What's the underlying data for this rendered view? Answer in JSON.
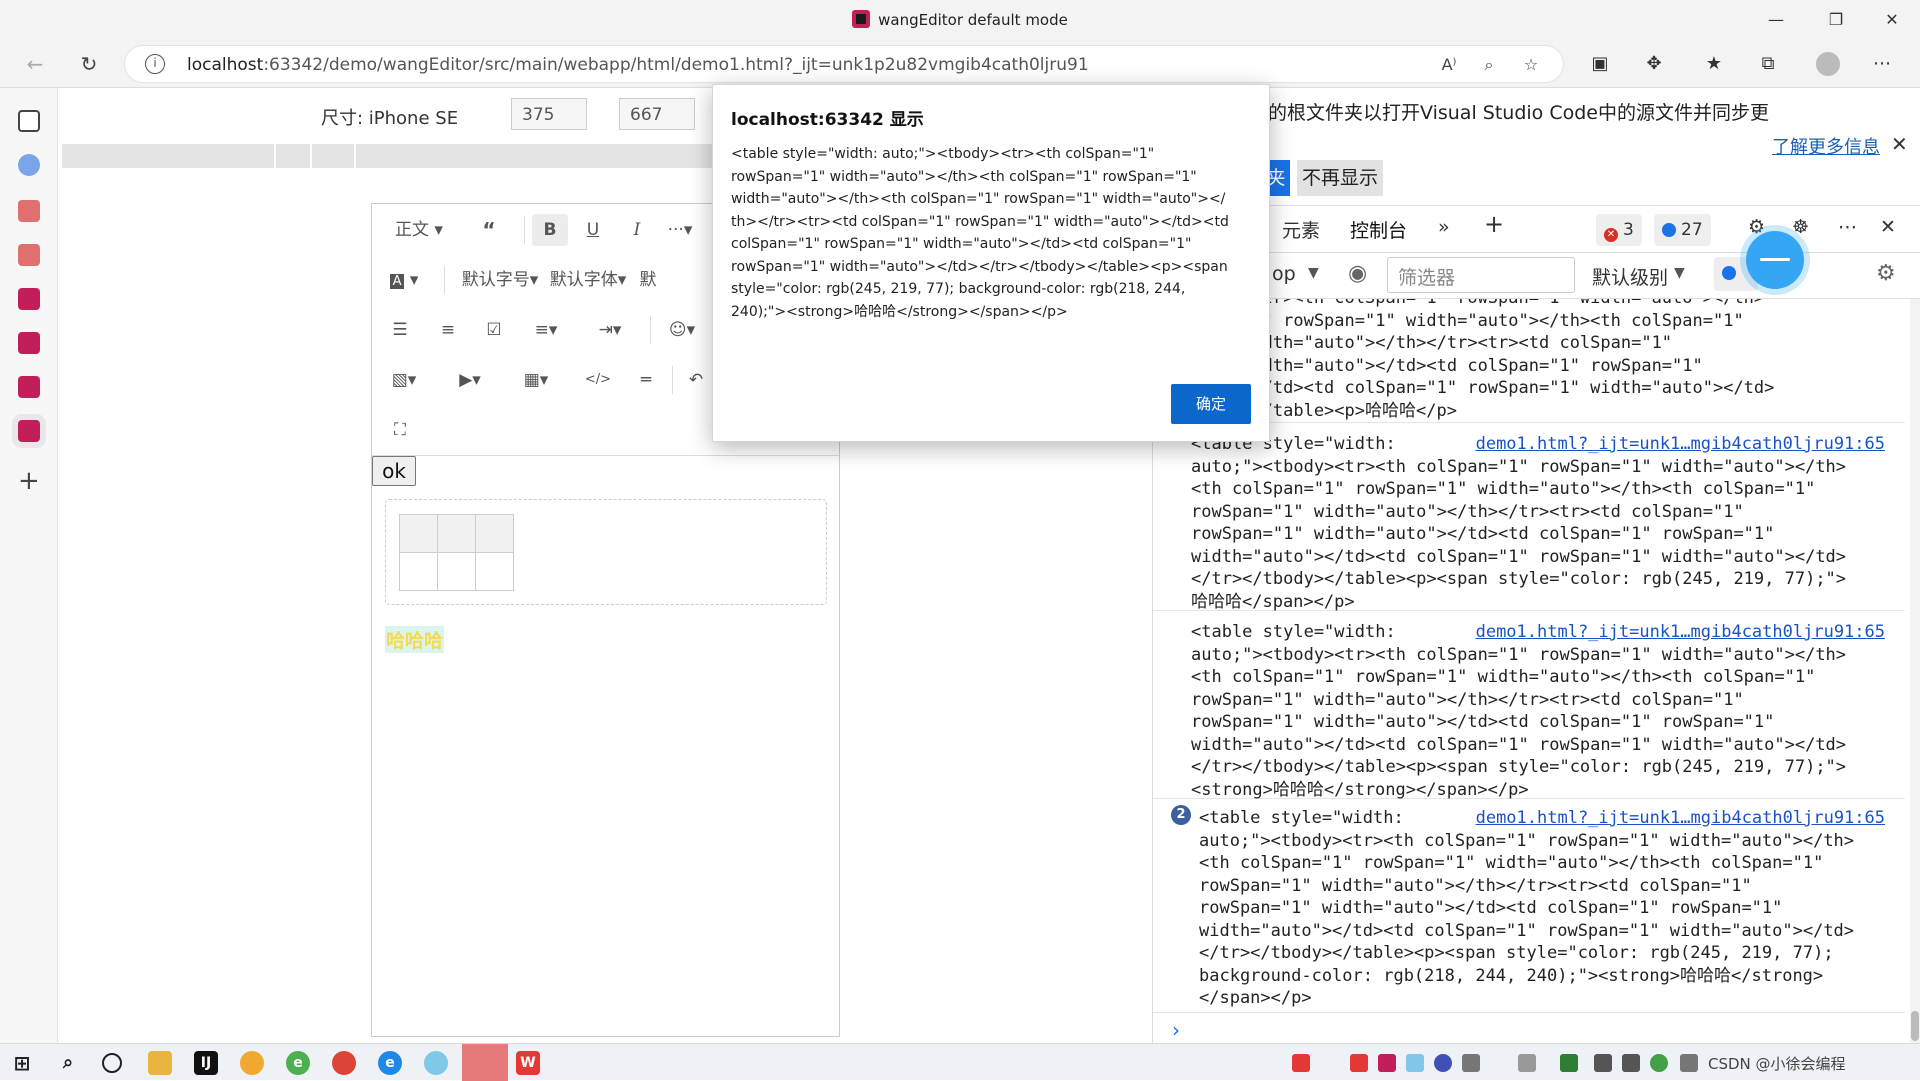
{
  "window": {
    "title": "wangEditor default mode"
  },
  "address_bar": {
    "url_host": "localhost",
    "url_rest": ":63342/demo/wangEditor/src/main/webapp/html/demo1.html?_ijt=unk1p2u82vmgib4cath0ljru91"
  },
  "device_toolbar": {
    "size_label": "尺寸: iPhone SE",
    "width": "375",
    "height": "667",
    "times": "×"
  },
  "editor": {
    "toolbar": {
      "row1": {
        "paragraph": "正文",
        "more": "···"
      },
      "row2": {
        "font_size": "默认字号",
        "font_family": "默认字体",
        "line_height": "默"
      }
    },
    "ok_button": "ok",
    "content_text": "哈哈哈",
    "text_color": "#f5db4d",
    "bg_color": "#daf4f0"
  },
  "banner": {
    "text": "的根文件夹以打开Visual Studio Code中的源文件并同步更",
    "learn_more": "了解更多信息",
    "open_button": "夹",
    "never_button": "不再显示"
  },
  "devtools": {
    "tabs": {
      "elements": "元素",
      "console": "控制台"
    },
    "error_count": "3",
    "message_count": "27",
    "context": "op",
    "filter_placeholder": "筛选器",
    "level": "默认级别",
    "level_badge": "2",
    "entries": [
      {
        "text": "tbody><tr><th colSpan=\"1\" rowSpan=\"1\" width=\"auto\"></th>\nSpan=\"1\" rowSpan=\"1\" width=\"auto\"></th><th colSpan=\"1\"\n=\"1\" width=\"auto\"></th></tr><tr><td colSpan=\"1\"\n=\"1\" width=\"auto\"></td><td colSpan=\"1\" rowSpan=\"1\"\nauto\"></td><td colSpan=\"1\" rowSpan=\"1\" width=\"auto\"></td>\ntbody></table><p>哈哈哈</p>",
        "source": ""
      },
      {
        "text": "<table style=\"width:\nauto;\"><tbody><tr><th colSpan=\"1\" rowSpan=\"1\" width=\"auto\"></th>\n<th colSpan=\"1\" rowSpan=\"1\" width=\"auto\"></th><th colSpan=\"1\"\nrowSpan=\"1\" width=\"auto\"></th></tr><tr><td colSpan=\"1\"\nrowSpan=\"1\" width=\"auto\"></td><td colSpan=\"1\" rowSpan=\"1\"\nwidth=\"auto\"></td><td colSpan=\"1\" rowSpan=\"1\" width=\"auto\"></td>\n</tr></tbody></table><p><span style=\"color: rgb(245, 219, 77);\">\n哈哈哈</span></p>",
        "source": "demo1.html?_ijt=unk1…mgib4cath0ljru91:65"
      },
      {
        "text": "<table style=\"width:\nauto;\"><tbody><tr><th colSpan=\"1\" rowSpan=\"1\" width=\"auto\"></th>\n<th colSpan=\"1\" rowSpan=\"1\" width=\"auto\"></th><th colSpan=\"1\"\nrowSpan=\"1\" width=\"auto\"></th></tr><tr><td colSpan=\"1\"\nrowSpan=\"1\" width=\"auto\"></td><td colSpan=\"1\" rowSpan=\"1\"\nwidth=\"auto\"></td><td colSpan=\"1\" rowSpan=\"1\" width=\"auto\"></td>\n</tr></tbody></table><p><span style=\"color: rgb(245, 219, 77);\">\n<strong>哈哈哈</strong></span></p>",
        "source": "demo1.html?_ijt=unk1…mgib4cath0ljru91:65"
      },
      {
        "count": "2",
        "text": "<table style=\"width:\nauto;\"><tbody><tr><th colSpan=\"1\" rowSpan=\"1\" width=\"auto\"></th>\n<th colSpan=\"1\" rowSpan=\"1\" width=\"auto\"></th><th colSpan=\"1\"\nrowSpan=\"1\" width=\"auto\"></th></tr><tr><td colSpan=\"1\"\nrowSpan=\"1\" width=\"auto\"></td><td colSpan=\"1\" rowSpan=\"1\"\nwidth=\"auto\"></td><td colSpan=\"1\" rowSpan=\"1\" width=\"auto\"></td>\n</tr></tbody></table><p><span style=\"color: rgb(245, 219, 77);\nbackground-color: rgb(218, 244, 240);\"><strong>哈哈哈</strong>\n</span></p>",
        "source": "demo1.html?_ijt=unk1…mgib4cath0ljru91:65"
      }
    ]
  },
  "dialog": {
    "title": "localhost:63342 显示",
    "message": "<table style=\"width: auto;\"><tbody><tr><th colSpan=\"1\"\nrowSpan=\"1\" width=\"auto\"></th><th colSpan=\"1\" rowSpan=\"1\"\nwidth=\"auto\"></th><th colSpan=\"1\" rowSpan=\"1\" width=\"auto\"></\nth></tr><tr><td colSpan=\"1\" rowSpan=\"1\" width=\"auto\"></td><td\ncolSpan=\"1\" rowSpan=\"1\" width=\"auto\"></td><td colSpan=\"1\"\nrowSpan=\"1\" width=\"auto\"></td></tr></tbody></table><p><span\nstyle=\"color: rgb(245, 219, 77); background-color: rgb(218, 244,\n240);\"><strong>哈哈哈</strong></span></p>",
    "ok_label": "确定"
  },
  "taskbar": {
    "tray_text": "CSDN @小徐会编程"
  }
}
